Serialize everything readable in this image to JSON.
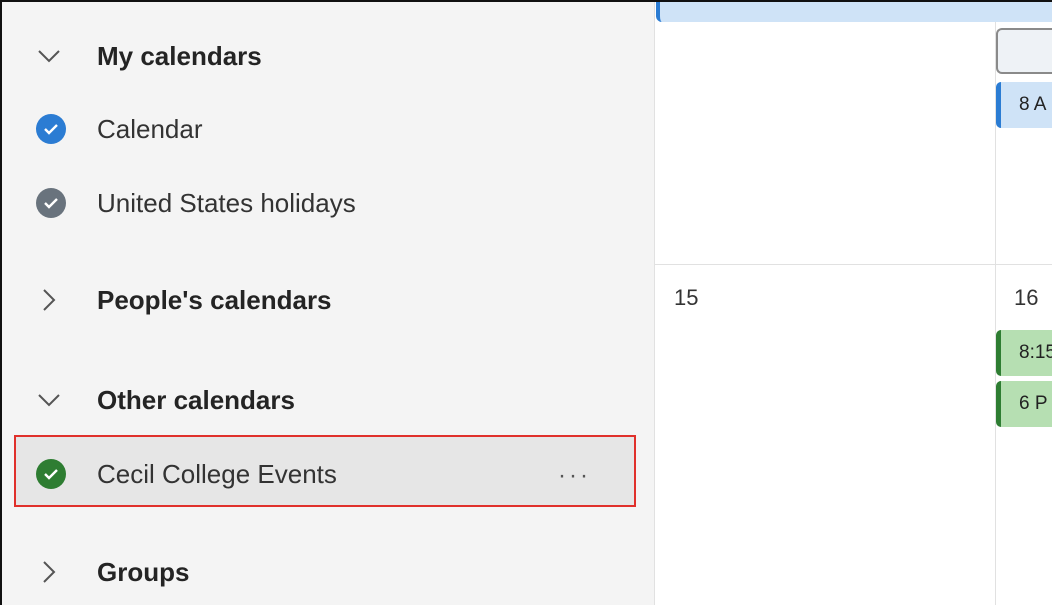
{
  "sidebar": {
    "my_calendars": {
      "title": "My calendars",
      "items": [
        {
          "label": "Calendar",
          "color": "#2b7cd3"
        },
        {
          "label": "United States holidays",
          "color": "#69737d"
        }
      ]
    },
    "peoples_calendars": {
      "title": "People's calendars"
    },
    "other_calendars": {
      "title": "Other calendars",
      "items": [
        {
          "label": "Cecil College Events",
          "color": "#2e7d32",
          "more": "···"
        }
      ]
    },
    "groups": {
      "title": "Groups"
    }
  },
  "calendar_grid": {
    "days": [
      {
        "number": "15"
      },
      {
        "number": "16"
      }
    ],
    "events": [
      {
        "label": "8 A",
        "color": "#2b7cd3"
      },
      {
        "label": "8:15",
        "color": "#2e7d32"
      },
      {
        "label": "6 P",
        "color": "#2e7d32"
      }
    ]
  }
}
